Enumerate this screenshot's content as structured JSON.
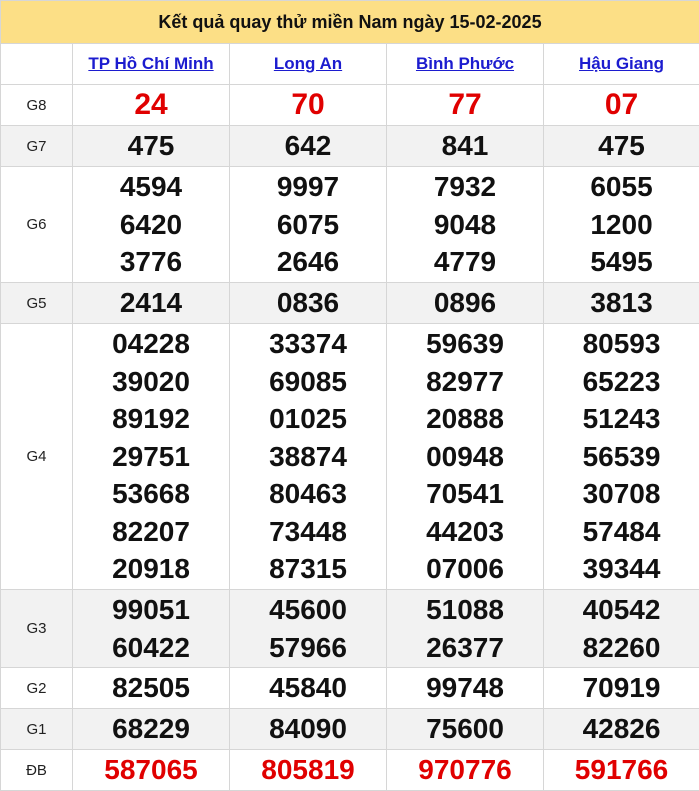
{
  "title": "Kết quả quay thử miền Nam ngày 15-02-2025",
  "provinces": [
    "TP Hồ Chí Minh",
    "Long An",
    "Bình Phước",
    "Hậu Giang"
  ],
  "prizes": [
    {
      "label": "G8",
      "values": [
        [
          "24"
        ],
        [
          "70"
        ],
        [
          "77"
        ],
        [
          "07"
        ]
      ]
    },
    {
      "label": "G7",
      "values": [
        [
          "475"
        ],
        [
          "642"
        ],
        [
          "841"
        ],
        [
          "475"
        ]
      ]
    },
    {
      "label": "G6",
      "values": [
        [
          "4594",
          "6420",
          "3776"
        ],
        [
          "9997",
          "6075",
          "2646"
        ],
        [
          "7932",
          "9048",
          "4779"
        ],
        [
          "6055",
          "1200",
          "5495"
        ]
      ]
    },
    {
      "label": "G5",
      "values": [
        [
          "2414"
        ],
        [
          "0836"
        ],
        [
          "0896"
        ],
        [
          "3813"
        ]
      ]
    },
    {
      "label": "G4",
      "values": [
        [
          "04228",
          "39020",
          "89192",
          "29751",
          "53668",
          "82207",
          "20918"
        ],
        [
          "33374",
          "69085",
          "01025",
          "38874",
          "80463",
          "73448",
          "87315"
        ],
        [
          "59639",
          "82977",
          "20888",
          "00948",
          "70541",
          "44203",
          "07006"
        ],
        [
          "80593",
          "65223",
          "51243",
          "56539",
          "30708",
          "57484",
          "39344"
        ]
      ]
    },
    {
      "label": "G3",
      "values": [
        [
          "99051",
          "60422"
        ],
        [
          "45600",
          "57966"
        ],
        [
          "51088",
          "26377"
        ],
        [
          "40542",
          "82260"
        ]
      ]
    },
    {
      "label": "G2",
      "values": [
        [
          "82505"
        ],
        [
          "45840"
        ],
        [
          "99748"
        ],
        [
          "70919"
        ]
      ]
    },
    {
      "label": "G1",
      "values": [
        [
          "68229"
        ],
        [
          "84090"
        ],
        [
          "75600"
        ],
        [
          "42826"
        ]
      ]
    },
    {
      "label": "ĐB",
      "values": [
        [
          "587065"
        ],
        [
          "805819"
        ],
        [
          "970776"
        ],
        [
          "591766"
        ]
      ]
    }
  ],
  "colors": {
    "title_bg": "#fcdf86",
    "highlight": "#e00000",
    "link": "#1c1ccf",
    "row_alt": "#f2f2f2"
  }
}
